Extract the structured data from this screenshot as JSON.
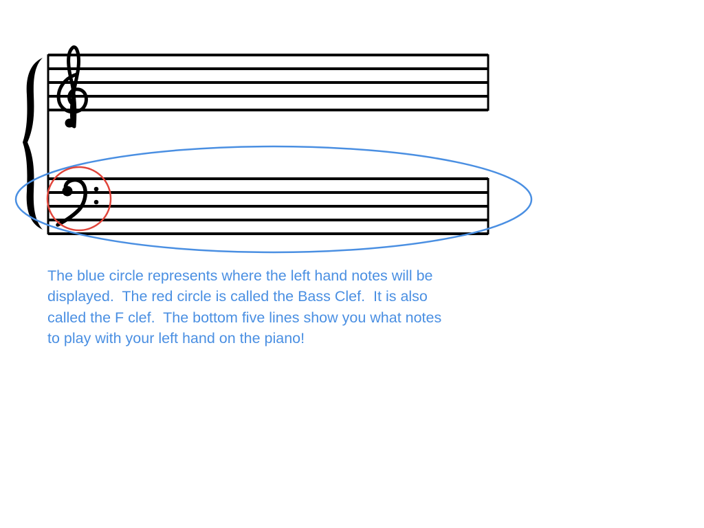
{
  "diagram": {
    "staves": [
      {
        "clef": "treble-clef",
        "line_count": 5
      },
      {
        "clef": "bass-clef",
        "line_count": 5
      }
    ],
    "highlights": {
      "left_hand_area": {
        "shape": "ellipse",
        "color": "#4a8fe2"
      },
      "bass_clef": {
        "shape": "circle",
        "color": "#e0443a"
      }
    },
    "ink_color": "#000000"
  },
  "caption": {
    "lines": [
      "The blue circle represents where the left hand notes will be",
      "displayed.  The red circle is called the Bass Clef.  It is also",
      "called the F clef.  The bottom five lines show you what notes",
      "to play with your left hand on the piano!"
    ],
    "color": "#4a8fe2"
  }
}
